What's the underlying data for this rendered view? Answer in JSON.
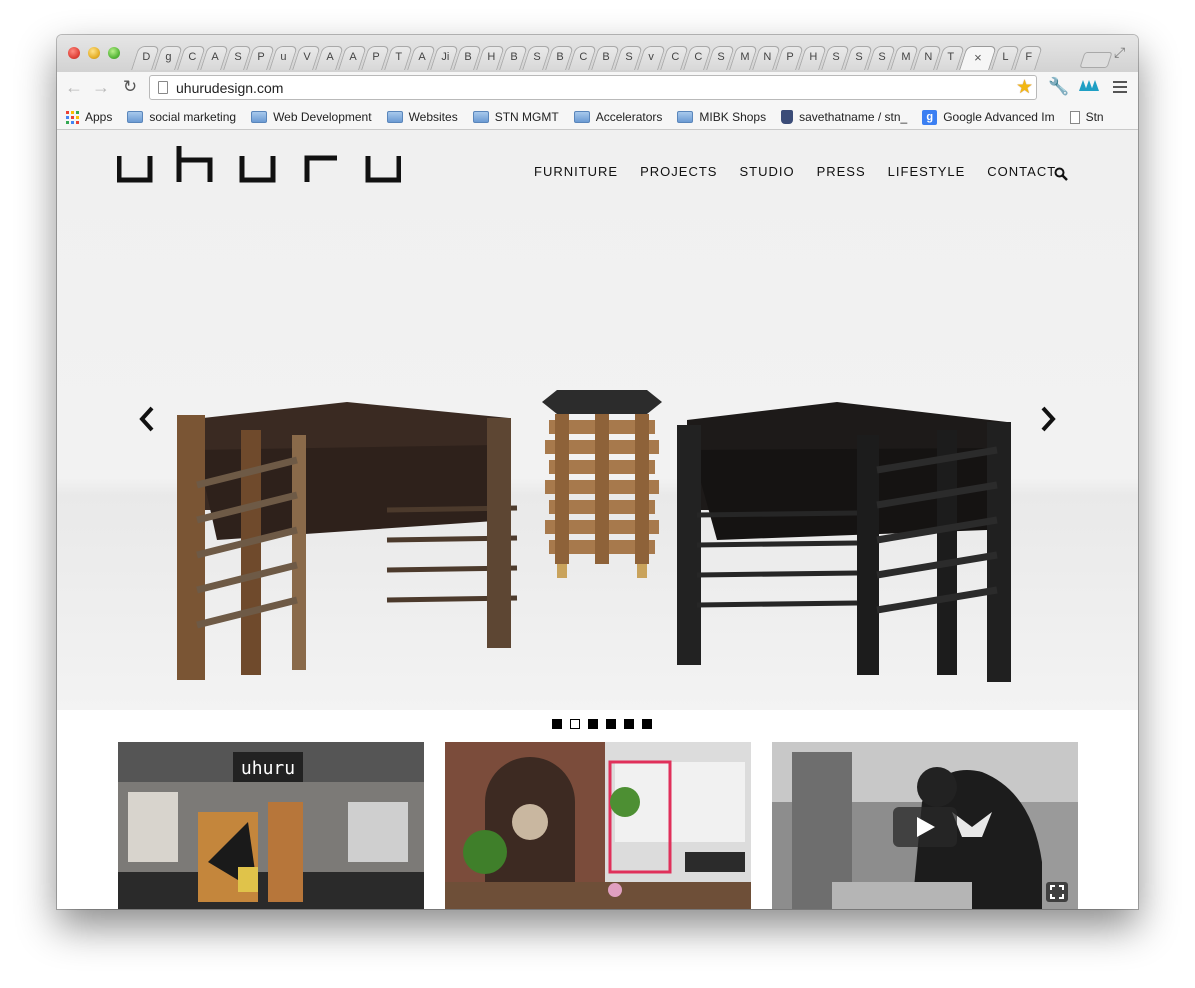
{
  "browser": {
    "tab_letters": [
      "D",
      "g",
      "C",
      "A",
      "S",
      "P",
      "u",
      "V",
      "A",
      "A",
      "P",
      "T",
      "A",
      "Ji",
      "B",
      "H",
      "B",
      "S",
      "B",
      "C",
      "B",
      "S",
      "v",
      "C",
      "C",
      "S",
      "M",
      "N",
      "P",
      "H",
      "S",
      "S",
      "S",
      "M",
      "N",
      "T"
    ],
    "active_tab_close": "×",
    "trailing_tab_letters": [
      "L",
      "F"
    ],
    "url": "uhurudesign.com",
    "bookmarks": [
      {
        "label": "Apps",
        "icon": "apps-grid-icon"
      },
      {
        "label": "social marketing",
        "icon": "folder-icon"
      },
      {
        "label": "Web Development",
        "icon": "folder-icon"
      },
      {
        "label": "Websites",
        "icon": "folder-icon"
      },
      {
        "label": "STN MGMT",
        "icon": "folder-icon"
      },
      {
        "label": "Accelerators",
        "icon": "folder-icon"
      },
      {
        "label": "MIBK Shops",
        "icon": "folder-icon"
      },
      {
        "label": "savethatname / stn_",
        "icon": "cup-icon"
      },
      {
        "label": "Google Advanced Im",
        "icon": "google-icon"
      },
      {
        "label": "Stn",
        "icon": "document-icon"
      }
    ]
  },
  "site": {
    "logo_text": "uhuru",
    "nav": [
      "FURNITURE",
      "PROJECTS",
      "STUDIO",
      "PRESS",
      "LIFESTYLE",
      "CONTACT"
    ],
    "slider": {
      "slide_count": 6,
      "active_index": 1
    },
    "thumbnails": [
      {
        "name": "trade-show-booth",
        "has_video": false
      },
      {
        "name": "studio-interior",
        "has_video": false
      },
      {
        "name": "workshop-video",
        "has_video": true
      }
    ]
  }
}
